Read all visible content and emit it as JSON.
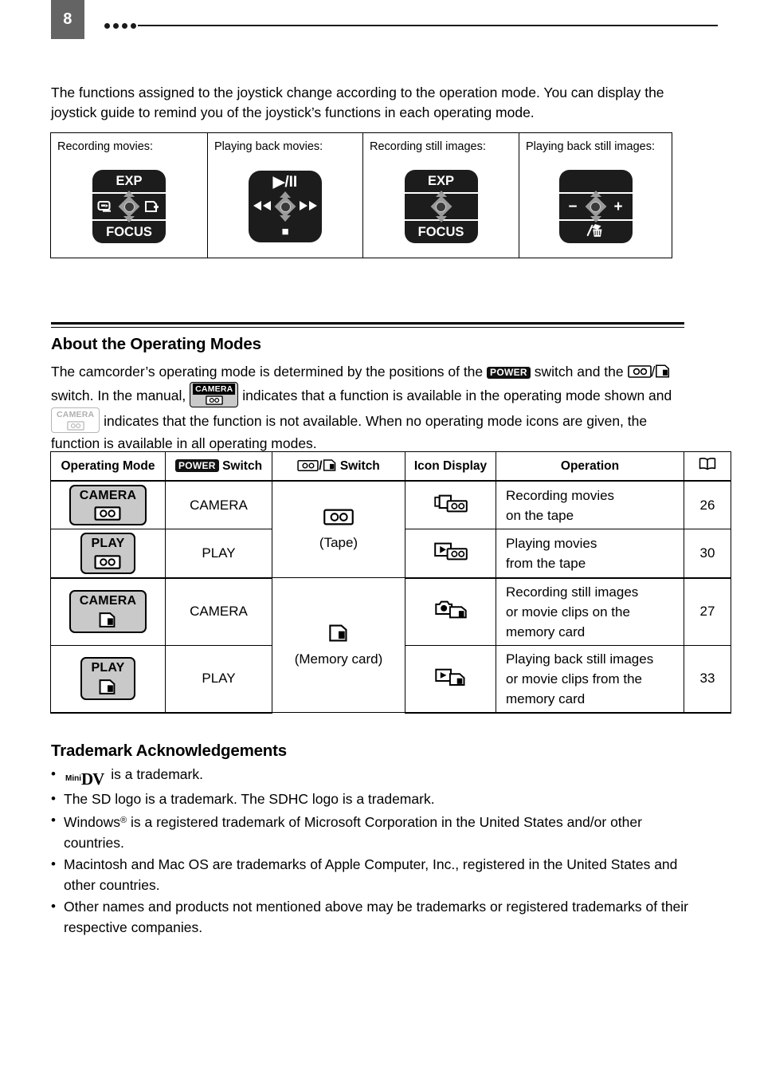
{
  "header": {
    "page_number": "8",
    "dots_count": 4
  },
  "intro": {
    "text": "The functions assigned to the joystick change according to the operation mode. You can display the joystick guide to remind you of the joystick’s functions in each operating mode."
  },
  "joystick_guide": {
    "columns": [
      {
        "label": "Recording movies:",
        "icon_name": "joystick-guide-recording-movies",
        "top_label": "EXP",
        "bottom_label": "FOCUS",
        "left_symbol": "tape-rewind-icon",
        "right_symbol": "card-add-icon"
      },
      {
        "label": "Playing back movies:",
        "icon_name": "joystick-guide-playing-movies",
        "top_label": "▶/II",
        "bottom_label": "■",
        "left_symbol": "rewind-icon",
        "right_symbol": "fast-forward-icon"
      },
      {
        "label": "Recording still images:",
        "icon_name": "joystick-guide-recording-stills",
        "top_label": "EXP",
        "bottom_label": "FOCUS",
        "left_symbol": "",
        "right_symbol": ""
      },
      {
        "label": "Playing back still images:",
        "icon_name": "joystick-guide-playing-stills",
        "top_label": "",
        "bottom_label": "erase-icon",
        "left_symbol": "−",
        "right_symbol": "+"
      }
    ]
  },
  "operating_modes": {
    "title": "About the Operating Modes",
    "paragraph": {
      "part1": "The camcorder’s operating mode is determined by the positions of the",
      "power_badge": "POWER",
      "part2": "switch and the",
      "tape_icon": "tape-icon",
      "slash": "/",
      "card_icon": "memory-card-icon",
      "part3": "switch. In the manual,",
      "camera_badge_on": "CAMERA",
      "part4": "indicates that a function is available in the operating mode shown and",
      "camera_badge_off": "CAMERA",
      "part5": "indicates that the function is not available. When no operating mode icons are given, the function is available in all operating modes."
    },
    "table": {
      "headers": {
        "operating_mode": "Operating Mode",
        "power_switch_badge": "POWER",
        "power_switch_label": "Switch",
        "media_switch_label": "Switch",
        "icon_display": "Icon Display",
        "operation": "Operation",
        "page_ref": "book-icon"
      },
      "media_groups": [
        {
          "icon": "tape-icon",
          "label": "(Tape)"
        },
        {
          "icon": "memory-card-icon",
          "label": "(Memory card)"
        }
      ],
      "rows": [
        {
          "mode_badge_top": "CAMERA",
          "mode_badge_media": "tape-icon",
          "power_switch": "CAMERA",
          "icon_display": "camcorder-tape-icon",
          "operation": "Recording movies\non the tape",
          "operation_line1": "Recording movies",
          "operation_line2": "on the tape",
          "operation_line3": "",
          "page": "26"
        },
        {
          "mode_badge_top": "PLAY",
          "mode_badge_media": "tape-icon",
          "power_switch": "PLAY",
          "icon_display": "play-tape-icon",
          "operation": "Playing movies\nfrom the tape",
          "operation_line1": "Playing movies",
          "operation_line2": "from the tape",
          "operation_line3": "",
          "page": "30"
        },
        {
          "mode_badge_top": "CAMERA",
          "mode_badge_media": "memory-card-icon",
          "power_switch": "CAMERA",
          "icon_display": "camera-card-icon",
          "operation": "Recording still images\nor movie clips on the\nmemory card",
          "operation_line1": "Recording still images",
          "operation_line2": "or movie clips on the",
          "operation_line3": "memory card",
          "page": "27"
        },
        {
          "mode_badge_top": "PLAY",
          "mode_badge_media": "memory-card-icon",
          "power_switch": "PLAY",
          "icon_display": "play-card-icon",
          "operation": "Playing back still images\nor movie clips from the\nmemory card",
          "operation_line1": "Playing back still images",
          "operation_line2": "or movie clips from the",
          "operation_line3": "memory card",
          "page": "33"
        }
      ]
    }
  },
  "trademarks": {
    "title": "Trademark Acknowledgements",
    "bullet": "•",
    "items": [
      {
        "has_logo": true,
        "logo_mini": "Mini",
        "logo_dv": "DV",
        "text": "is a trademark."
      },
      {
        "has_logo": false,
        "text": "The SD logo is a trademark. The SDHC logo is a trademark."
      },
      {
        "has_logo": false,
        "prefix": "Windows",
        "sup": "®",
        "text": "is a registered trademark of Microsoft Corporation in the United States and/or other countries."
      },
      {
        "has_logo": false,
        "text": "Macintosh and Mac OS are trademarks of Apple Computer, Inc., registered in the United States and other countries."
      },
      {
        "has_logo": false,
        "text": "Other names and products not mentioned above may be trademarks or registered trademarks of their respective companies."
      }
    ]
  },
  "colors": {
    "page_tab_gray": "#646464",
    "badge_gray": "#c9c9c9",
    "ink": "#000000",
    "joystick_black": "#1c1c1c",
    "joystick_diamond": "#9a9a9a"
  }
}
